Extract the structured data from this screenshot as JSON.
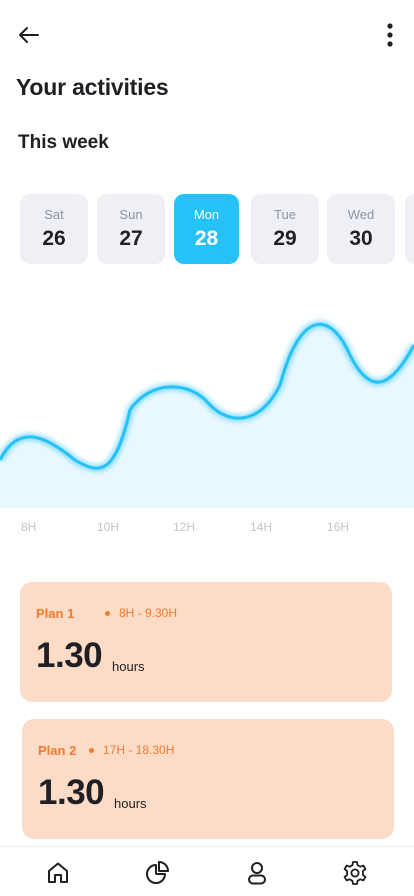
{
  "header": {
    "title": "Your activities",
    "section_title": "This week"
  },
  "days": [
    {
      "name": "Sat",
      "number": "26",
      "selected": false
    },
    {
      "name": "Sun",
      "number": "27",
      "selected": false
    },
    {
      "name": "Mon",
      "number": "28",
      "selected": true
    },
    {
      "name": "Tue",
      "number": "29",
      "selected": false
    },
    {
      "name": "Wed",
      "number": "30",
      "selected": false
    }
  ],
  "chart_data": {
    "type": "area",
    "x_ticks": [
      "8H",
      "10H",
      "12H",
      "14H",
      "16H"
    ],
    "line_color": "#25c1f7",
    "fill_color": "#e8f8fe"
  },
  "plans": [
    {
      "name": "Plan 1",
      "time": "8H - 9.30H",
      "value": "1.30",
      "unit": "hours"
    },
    {
      "name": "Plan 2",
      "time": "17H - 18.30H",
      "value": "1.30",
      "unit": "hours"
    }
  ],
  "nav": {
    "items": [
      "home-icon",
      "chart-pie-icon",
      "profile-icon",
      "settings-icon"
    ]
  },
  "colors": {
    "accent": "#25c1f7",
    "plan_bg": "#fcdcc6",
    "plan_text": "#f07a2e",
    "day_bg": "#eef0f6"
  }
}
